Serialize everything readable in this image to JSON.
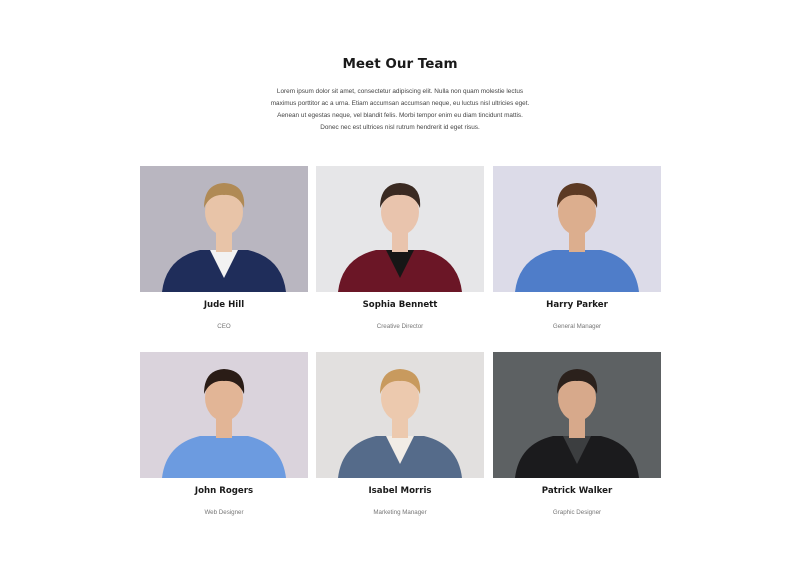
{
  "section": {
    "title": "Meet Our Team",
    "intro": [
      "Lorem ipsum dolor sit amet, consectetur adipiscing elit. Nulla non quam molestie lectus",
      "maximus porttitor ac a urna. Etiam accumsan accumsan neque, eu luctus nisl ultricies eget.",
      "Aenean ut egestas neque, vel blandit felis. Morbi tempor enim eu diam tincidunt mattis.",
      "Donec nec est ultrices nisl rutrum hendrerit id eget risus."
    ]
  },
  "team": [
    {
      "name": "Jude Hill",
      "role": "CEO",
      "bg": "#b9b6c0",
      "skin": "#e8c4a8",
      "hair": "#b08a55",
      "shirt": "#f2f2f2",
      "jacket": "#1f2d5a"
    },
    {
      "name": "Sophia Bennett",
      "role": "Creative Director",
      "bg": "#e6e6e8",
      "skin": "#e9c4ad",
      "hair": "#3a2a22",
      "shirt": "#161616",
      "jacket": "#6b1626"
    },
    {
      "name": "Harry Parker",
      "role": "General Manager",
      "bg": "#dcdbe8",
      "skin": "#dcae8e",
      "hair": "#5c3a24",
      "shirt": "#4f7dc9",
      "jacket": "#4f7dc9"
    },
    {
      "name": "John Rogers",
      "role": "Web Designer",
      "bg": "#dad3dc",
      "skin": "#e2b596",
      "hair": "#2a1c16",
      "shirt": "#6c9be0",
      "jacket": "#6c9be0"
    },
    {
      "name": "Isabel Morris",
      "role": "Marketing Manager",
      "bg": "#e2e0df",
      "skin": "#ecc9ae",
      "hair": "#c89a5e",
      "shirt": "#f1ece6",
      "jacket": "#556b8a"
    },
    {
      "name": "Patrick Walker",
      "role": "Graphic Designer",
      "bg": "#5d6163",
      "skin": "#d7a98b",
      "hair": "#2b211c",
      "shirt": "#3c3e40",
      "jacket": "#1b1b1d"
    }
  ]
}
